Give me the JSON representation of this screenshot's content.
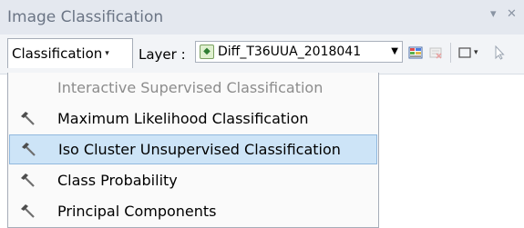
{
  "window": {
    "title": "Image Classification",
    "dropdown_glyph": "▾",
    "close_glyph": "✕"
  },
  "toolbar": {
    "classification_label": "Classification",
    "layer_label": "Layer :",
    "layer_value": "Diff_T36UUA_2018041",
    "icons": [
      "raster-layer-icon",
      "training-sample-manager-icon",
      "clear-samples-icon",
      "draw-polygon-icon",
      "select-training-sample-icon"
    ]
  },
  "menu": {
    "items": [
      {
        "label": "Interactive Supervised Classification",
        "enabled": false,
        "icon": "none"
      },
      {
        "label": "Maximum Likelihood Classification",
        "enabled": true,
        "icon": "hammer-icon"
      },
      {
        "label": "Iso Cluster Unsupervised Classification",
        "enabled": true,
        "icon": "hammer-icon",
        "highlighted": true
      },
      {
        "label": "Class Probability",
        "enabled": true,
        "icon": "hammer-icon"
      },
      {
        "label": "Principal Components",
        "enabled": true,
        "icon": "hammer-icon"
      }
    ]
  },
  "colors": {
    "titlebar_bg": "#e4e8ef",
    "title_text": "#6b7585",
    "highlight_bg": "#cde4f7",
    "highlight_border": "#90b8de",
    "disabled_text": "#8c8c8c"
  }
}
